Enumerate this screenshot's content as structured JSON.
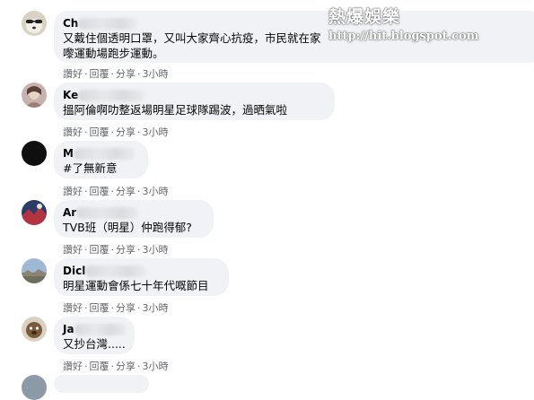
{
  "comments": [
    {
      "name_visible": "Ch",
      "text_lines": [
        "又戴住個透明口罩，又叫大家齊心抗疫，市民就在家 ，藝人就 嚟運動場跑步運動。"
      ],
      "text_line1": "又戴住個透明口罩，又叫大家齊心抗疫，市民就在家",
      "text_line2": "嚟運動場跑步運動。",
      "actions": {
        "like": "讚好",
        "reply": "回覆",
        "share": "分享",
        "time": "3小時"
      }
    },
    {
      "name_visible": "Ke",
      "text": "搵阿倫啊叻整返場明星足球隊踢波，過晒氣啦",
      "actions": {
        "like": "讚好",
        "reply": "回覆",
        "share": "分享",
        "time": "3小時"
      }
    },
    {
      "name_visible": "M",
      "text": "#了無新意",
      "actions": {
        "like": "讚好",
        "reply": "回覆",
        "share": "分享",
        "time": "3小時"
      }
    },
    {
      "name_visible": "Ar",
      "text": "TVB班（明星）仲跑得郁?",
      "actions": {
        "like": "讚好",
        "reply": "回覆",
        "share": "分享",
        "time": "3小時"
      }
    },
    {
      "name_visible": "Dicl",
      "text": "明星運動會係七十年代嘅節目",
      "actions": {
        "like": "讚好",
        "reply": "回覆",
        "share": "分享",
        "time": "3小時"
      }
    },
    {
      "name_visible": "Ja",
      "text": "又抄台灣.....",
      "actions": {
        "like": "讚好",
        "reply": "回覆",
        "share": "分享",
        "time": "3小時"
      }
    }
  ],
  "watermark": {
    "title": "熱爆娛樂",
    "url": "http://hit.blogspot.com"
  }
}
